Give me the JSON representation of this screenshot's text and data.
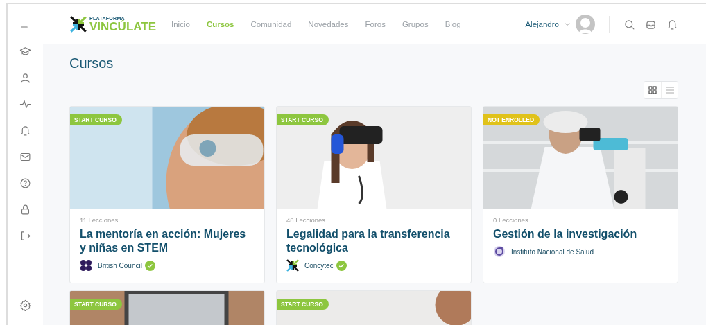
{
  "header": {
    "logo": {
      "small": "PLATAFORMA",
      "name": "VINCÚLATE"
    },
    "nav": [
      {
        "label": "Inicio",
        "selected": false
      },
      {
        "label": "Cursos",
        "selected": true
      },
      {
        "label": "Comunidad",
        "selected": false
      },
      {
        "label": "Novedades",
        "selected": false
      },
      {
        "label": "Foros",
        "selected": false
      },
      {
        "label": "Grupos",
        "selected": false
      },
      {
        "label": "Blog",
        "selected": false
      }
    ],
    "user": {
      "name": "Alejandro"
    }
  },
  "page": {
    "title": "Cursos",
    "view": [
      {
        "kind": "grid",
        "selected": true
      },
      {
        "kind": "list",
        "selected": false
      }
    ]
  },
  "courses": [
    {
      "badge": {
        "text": "START CURSO",
        "color": "#8dc63f"
      },
      "lessons": "11 Lecciones",
      "title": "La mentoría en acción: Mujeres y niñas en STEM",
      "org": "British Council",
      "verified": true
    },
    {
      "badge": {
        "text": "START CURSO",
        "color": "#8dc63f"
      },
      "lessons": "48 Lecciones",
      "title": "Legalidad para la transferencia tecnológica",
      "org": "Concytec",
      "verified": true
    },
    {
      "badge": {
        "text": "NOT ENROLLED",
        "color": "#e0c21a"
      },
      "lessons": "0 Lecciones",
      "title": "Gestión de la investigación",
      "org": "Instituto Nacional de Salud",
      "verified": false
    },
    {
      "badge": {
        "text": "START CURSO",
        "color": "#8dc63f"
      }
    },
    {
      "badge": {
        "text": "START CURSO",
        "color": "#8dc63f"
      }
    }
  ]
}
